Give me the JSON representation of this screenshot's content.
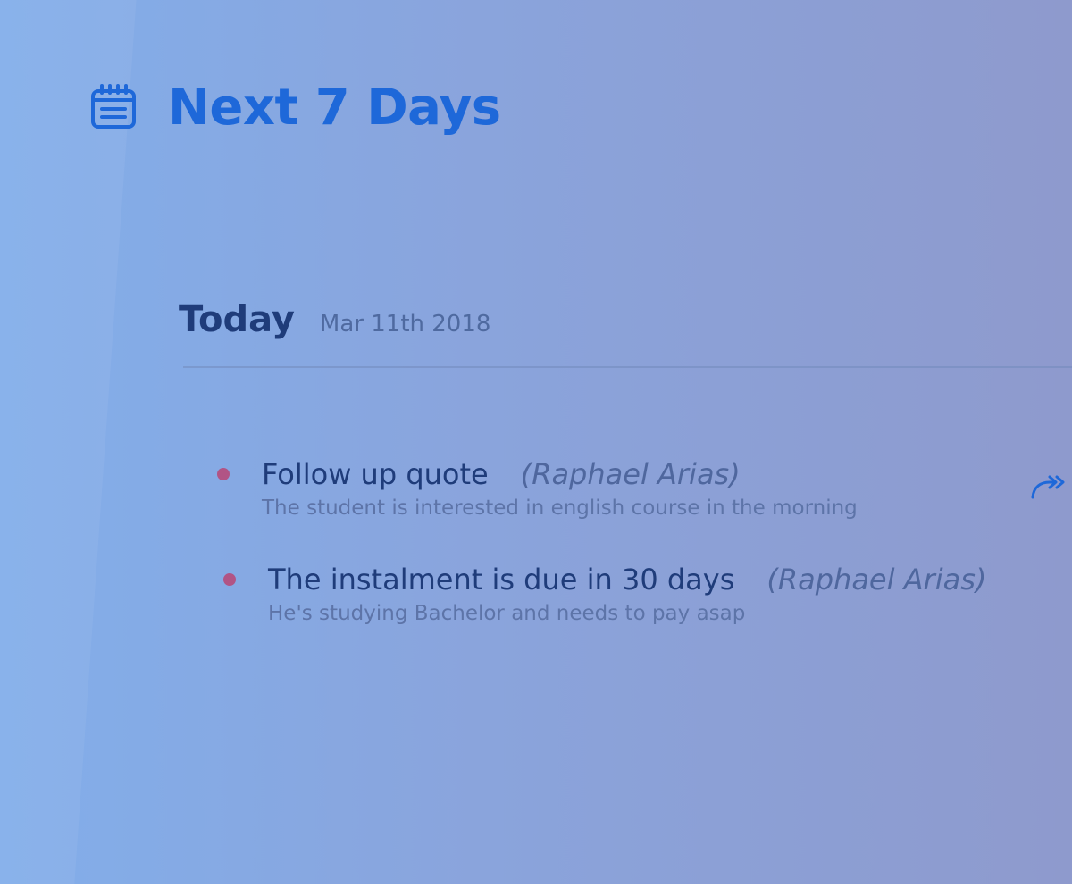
{
  "header": {
    "icon": "calendar-icon",
    "title": "Next 7 Days"
  },
  "section": {
    "label": "Today",
    "date": "Mar 11th 2018"
  },
  "tasks": [
    {
      "title": "Follow up quote",
      "person": "(Raphael Arias)",
      "description": "The student is interested in english course in the morning",
      "action_icon": "forward-icon"
    },
    {
      "title": "The instalment is due in 30 days",
      "person": "(Raphael Arias)",
      "description": "He's studying Bachelor and needs to pay asap"
    }
  ],
  "colors": {
    "accent": "#1e68d9",
    "heading": "#1f3c7a",
    "bullet": "#b15485",
    "muted_text": "#5d74a8"
  }
}
